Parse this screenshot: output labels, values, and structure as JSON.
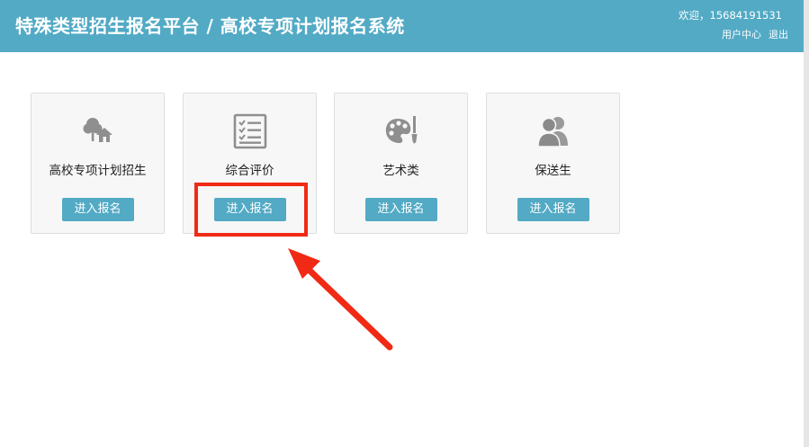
{
  "header": {
    "brand": "特殊类型招生报名平台 / 高校专项计划报名系统",
    "welcome": "欢迎，15684191531",
    "user_center": "用户中心",
    "logout": "退出"
  },
  "cards": [
    {
      "title": "高校专项计划招生",
      "button": "进入报名",
      "icon": "tree-house-icon"
    },
    {
      "title": "综合评价",
      "button": "进入报名",
      "icon": "checklist-icon"
    },
    {
      "title": "艺术类",
      "button": "进入报名",
      "icon": "palette-icon"
    },
    {
      "title": "保送生",
      "button": "进入报名",
      "icon": "users-icon"
    }
  ],
  "colors": {
    "header_bg": "#52aac5",
    "button_bg": "#52aac5",
    "annotation": "#f02a15"
  }
}
